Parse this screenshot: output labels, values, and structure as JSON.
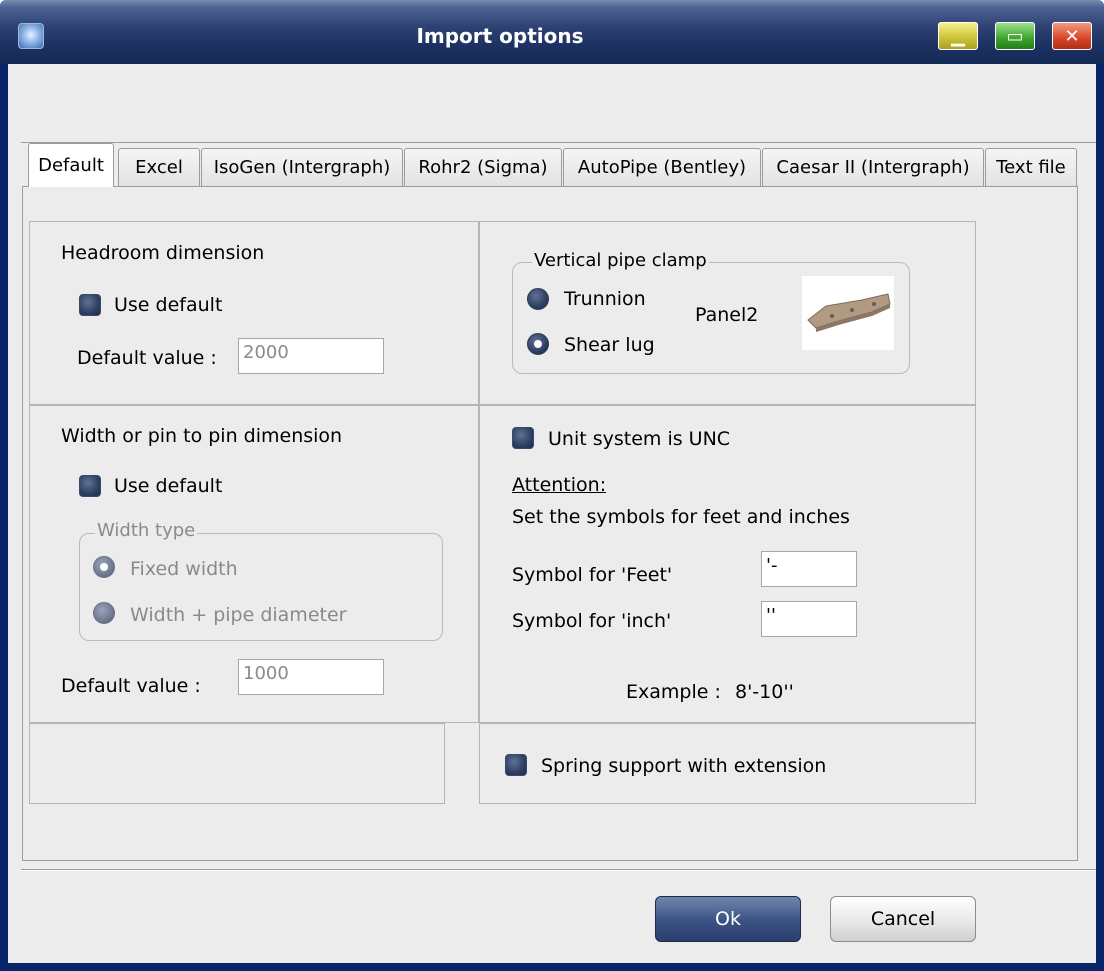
{
  "window": {
    "title": "Import options"
  },
  "tabs": [
    {
      "label": "Default",
      "active": true
    },
    {
      "label": "Excel",
      "active": false
    },
    {
      "label": "IsoGen (Intergraph)",
      "active": false
    },
    {
      "label": "Rohr2 (Sigma)",
      "active": false
    },
    {
      "label": "AutoPipe (Bentley)",
      "active": false
    },
    {
      "label": "Caesar II (Intergraph)",
      "active": false
    },
    {
      "label": "Text file",
      "active": false
    }
  ],
  "headroom": {
    "title": "Headroom dimension",
    "use_default_label": "Use default",
    "use_default_checked": false,
    "default_value_label": "Default value :",
    "default_value": "2000"
  },
  "vertical_clamp": {
    "legend": "Vertical pipe clamp",
    "options": [
      "Trunnion",
      "Shear lug"
    ],
    "selected": "Shear lug",
    "panel_label": "Panel2"
  },
  "width": {
    "title": "Width or pin to pin dimension",
    "use_default_label": "Use default",
    "use_default_checked": false,
    "width_type_legend": "Width type",
    "width_type_options": [
      "Fixed width",
      "Width + pipe diameter"
    ],
    "width_type_selected": "Fixed width",
    "default_value_label": "Default value :",
    "default_value": "1000"
  },
  "unc": {
    "checkbox_label": "Unit system is UNC",
    "checked": false,
    "attention_heading": "Attention:",
    "attention_text": "Set the symbols for feet and inches",
    "feet_label": "Symbol for 'Feet'",
    "feet_value": "'-",
    "inch_label": "Symbol for 'inch'",
    "inch_value": "''",
    "example_label": "Example :",
    "example_value": "8'-10''"
  },
  "spring": {
    "checkbox_label": "Spring support with extension",
    "checked": false
  },
  "buttons": {
    "ok": "Ok",
    "cancel": "Cancel"
  },
  "colors": {
    "titlebar": "#1d3262",
    "client": "#ececec",
    "ok_button": "#3a5284"
  }
}
